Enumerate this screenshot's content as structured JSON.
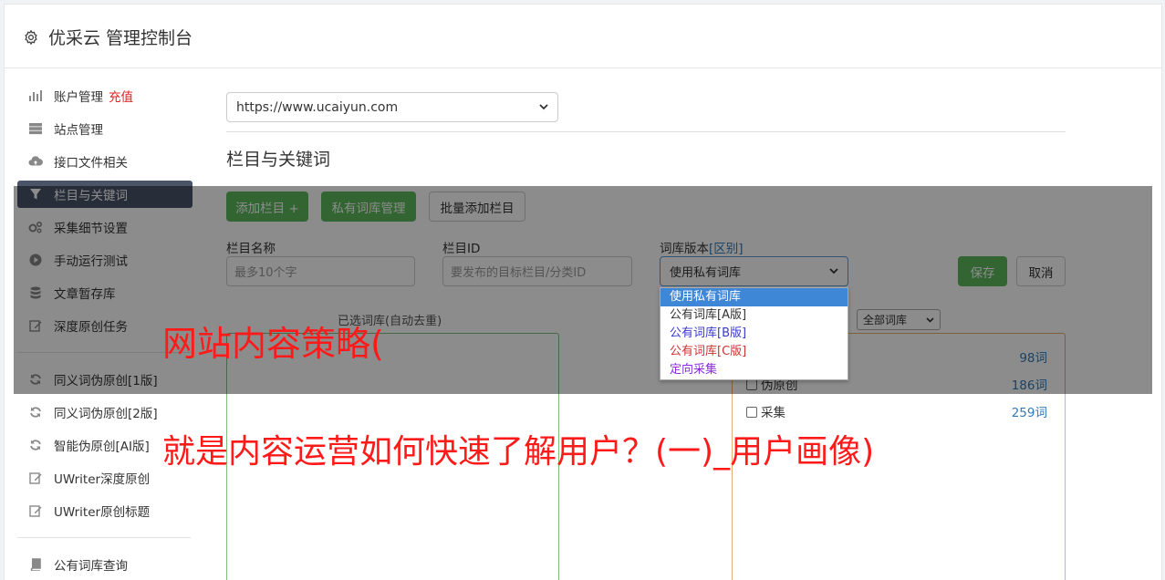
{
  "header": {
    "title": "优采云 管理控制台"
  },
  "sidebar": {
    "items": [
      {
        "label": "账户管理",
        "badge": "充值",
        "icon": "bar-chart-icon"
      },
      {
        "label": "站点管理",
        "icon": "server-icon"
      },
      {
        "label": "接口文件相关",
        "icon": "cloud-upload-icon"
      },
      {
        "label": "栏目与关键词",
        "icon": "filter-icon",
        "active": true
      },
      {
        "label": "采集细节设置",
        "icon": "cogs-icon"
      },
      {
        "label": "手动运行测试",
        "icon": "play-circle-icon"
      },
      {
        "label": "文章暂存库",
        "icon": "database-icon"
      },
      {
        "label": "深度原创任务",
        "icon": "edit-icon"
      }
    ],
    "items2": [
      {
        "label": "同义词伪原创[1版]",
        "icon": "refresh-icon"
      },
      {
        "label": "同义词伪原创[2版]",
        "icon": "refresh-icon"
      },
      {
        "label": "智能伪原创[AI版]",
        "icon": "refresh-icon"
      },
      {
        "label": "UWriter深度原创",
        "icon": "edit-icon"
      },
      {
        "label": "UWriter原创标题",
        "icon": "edit-icon"
      }
    ],
    "items3": [
      {
        "label": "公有词库查询",
        "icon": "book-icon"
      }
    ]
  },
  "main": {
    "site_select": "https://www.ucaiyun.com",
    "section_title": "栏目与关键词",
    "buttons": {
      "add_column": "添加栏目 +",
      "private_lib": "私有词库管理",
      "batch_add": "批量添加栏目"
    },
    "form": {
      "column_name_label": "栏目名称",
      "column_name_placeholder": "最多10个字",
      "column_id_label": "栏目ID",
      "column_id_placeholder": "要发布的目标栏目/分类ID",
      "lib_version_label": "词库版本",
      "lib_version_link": "[区别]",
      "lib_version_value": "使用私有词库",
      "save": "保存",
      "cancel": "取消"
    },
    "dropdown_options": [
      "使用私有词库",
      "公有词库[A版]",
      "公有词库[B版]",
      "公有词库[C版]",
      "定向采集"
    ],
    "dropdown_colors": [
      "#ffffff",
      "#333333",
      "#3a3acc",
      "#cc3333",
      "#8a2be2"
    ],
    "candidate_caption": "已选词库(自动去重)",
    "all_libs_select": "全部词库",
    "libs": [
      {
        "label": "",
        "count": "98词"
      },
      {
        "label": "伪原创",
        "count": "186词"
      },
      {
        "label": "采集",
        "count": "259词"
      }
    ]
  },
  "banner": {
    "line1": "网站内容策略(",
    "line2": "就是内容运营如何快速了解用户？(一)_用户画像)"
  }
}
